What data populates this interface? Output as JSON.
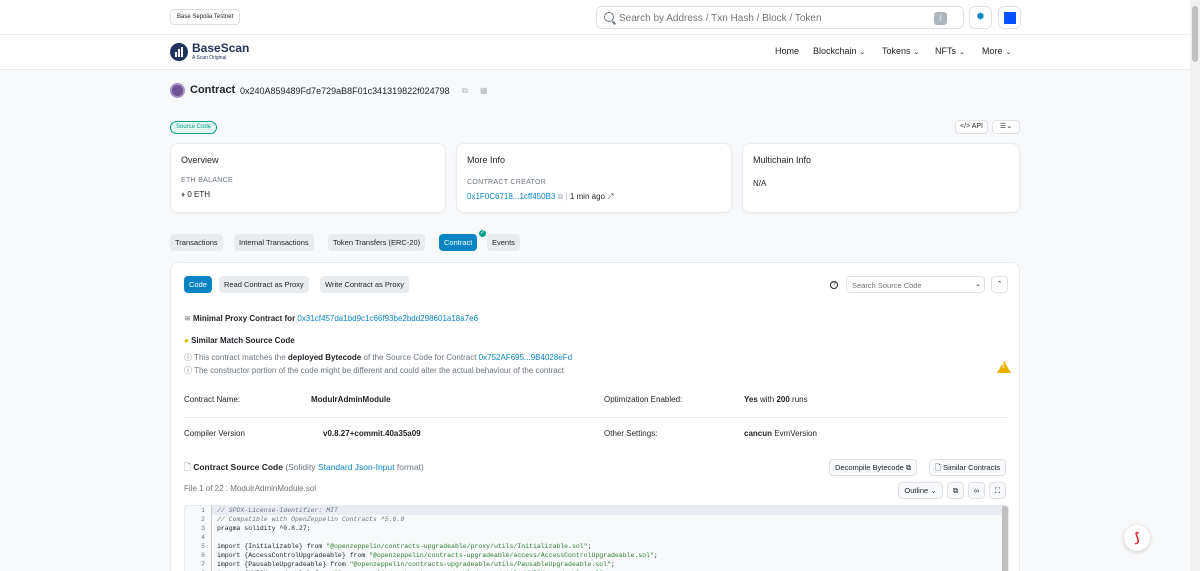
{
  "topbar": {
    "network": "Base Sepolia Testnet",
    "search_placeholder": "Search by Address / Txn Hash / Block / Token",
    "slash": "/",
    "theme_icon": "sun-icon"
  },
  "header": {
    "brand": "BaseScan",
    "tagline": "A Scan Original",
    "nav": [
      {
        "label": "Home"
      },
      {
        "label": "Blockchain"
      },
      {
        "label": "Tokens"
      },
      {
        "label": "NFTs"
      },
      {
        "label": "More"
      }
    ]
  },
  "contract": {
    "title": "Contract",
    "address": "0x240A859489Fd7e729aB8F01c341319822f024798"
  },
  "source_badge": "Source Code",
  "api_label": "API",
  "overview": {
    "title": "Overview",
    "balance_label": "ETH BALANCE",
    "balance_value": "0 ETH"
  },
  "more_info": {
    "title": "More Info",
    "creator_label": "CONTRACT CREATOR",
    "creator_address": "0x1F0C6718...1cff450B3",
    "separator": "|",
    "creator_time": "1 min ago"
  },
  "multichain": {
    "title": "Multichain Info",
    "value": "N/A"
  },
  "tabs": [
    {
      "label": "Transactions"
    },
    {
      "label": "Internal Transactions"
    },
    {
      "label": "Token Transfers (ERC-20)"
    },
    {
      "label": "Contract"
    },
    {
      "label": "Events"
    }
  ],
  "subtabs": [
    {
      "label": "Code"
    },
    {
      "label": "Read Contract as Proxy"
    },
    {
      "label": "Write Contract as Proxy"
    }
  ],
  "source_search_placeholder": "Search Source Code",
  "proxy": {
    "label": "Minimal Proxy Contract for",
    "address": "0x31cf457da1bd9c1c66f93be2bdd298601a18a7e6"
  },
  "similar": {
    "title": "Similar Match Source Code",
    "line1_a": "This contract matches the ",
    "line1_b": "deployed Bytecode",
    "line1_c": " of the Source Code for Contract ",
    "line1_link": "0x752AF695...9B4028eFd",
    "line2": "The constructor portion of the code might be different and could alter the actual behaviour of the contract"
  },
  "details": {
    "name_label": "Contract Name:",
    "name_value": "ModulrAdminModule",
    "opt_label": "Optimization Enabled:",
    "opt_value_a": "Yes",
    "opt_value_b": " with ",
    "opt_value_c": "200",
    "opt_value_d": " runs",
    "compiler_label": "Compiler Version",
    "compiler_value": "v0.8.27+commit.40a35a09",
    "settings_label": "Other Settings:",
    "settings_value_a": "cancun",
    "settings_value_b": " EvmVersion"
  },
  "source": {
    "title": "Contract Source Code",
    "meta_a": " (Solidity ",
    "meta_link": "Standard Json-Input",
    "meta_b": " format)",
    "decompile": "Decompile Bytecode",
    "similar": "Similar Contracts",
    "file": "File 1 of 22 : ModulrAdminModule.sol",
    "outline": "Outline"
  },
  "code_lines": [
    {
      "n": "1",
      "text": "// SPDX-License-Identifier: MIT",
      "kind": "comment"
    },
    {
      "n": "2",
      "text": "// Compatible with OpenZeppelin Contracts ^5.6.0",
      "kind": "comment"
    },
    {
      "n": "3",
      "text": "pragma solidity ^0.8.27;",
      "kind": "code"
    },
    {
      "n": "4",
      "text": "",
      "kind": "code"
    },
    {
      "n": "5",
      "pre": "import {Initializable} from ",
      "str": "\"@openzeppelin/contracts-upgradeable/proxy/utils/Initializable.sol\"",
      "post": ";",
      "kind": "import"
    },
    {
      "n": "6",
      "pre": "import {AccessControlUpgradeable} from ",
      "str": "\"@openzeppelin/contracts-upgradeable/access/AccessControlUpgradeable.sol\"",
      "post": ";",
      "kind": "import"
    },
    {
      "n": "7",
      "pre": "import {PausableUpgradeable} from ",
      "str": "\"@openzeppelin/contracts-upgradeable/utils/PausableUpgradeable.sol\"",
      "post": ";",
      "kind": "import"
    },
    {
      "n": "8",
      "pre": "import {UUPSUpgradeable} from ",
      "str": "\"@openzeppelin/contracts-upgradeable/proxy/utils/UUPSUpgradeable.sol\"",
      "post": ";",
      "kind": "import"
    }
  ]
}
